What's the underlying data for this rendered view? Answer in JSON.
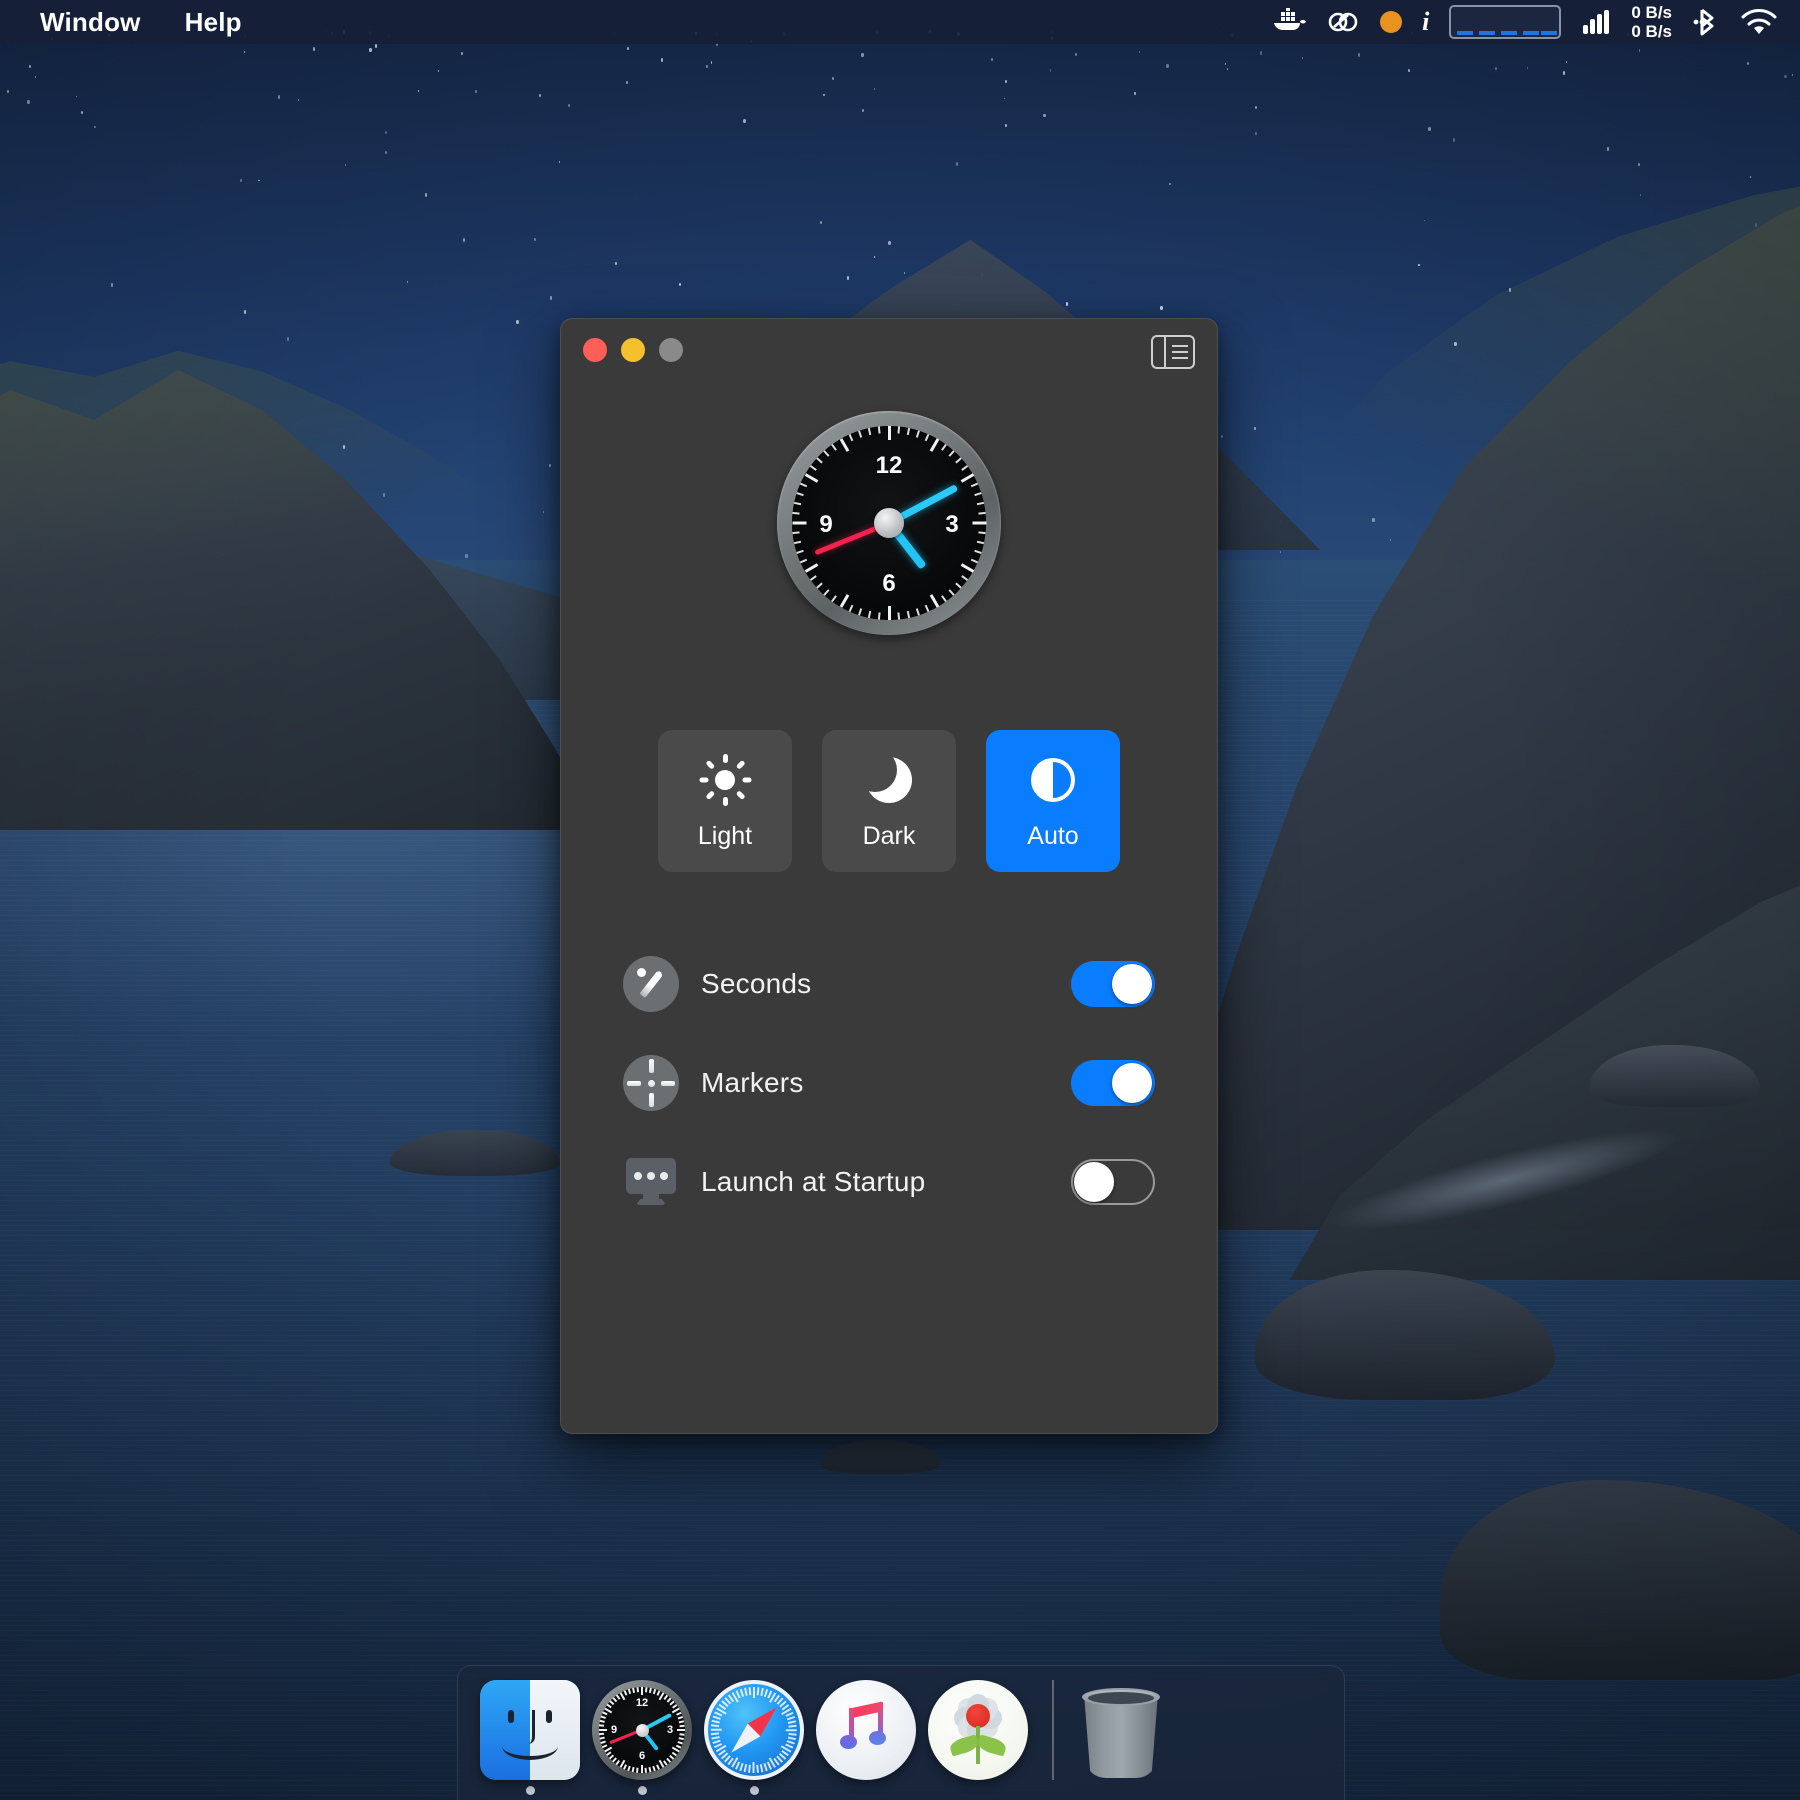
{
  "menubar": {
    "items": [
      {
        "label": "Window",
        "name": "menu-window"
      },
      {
        "label": "Help",
        "name": "menu-help"
      }
    ],
    "status": {
      "docker_icon": "docker-whale-icon",
      "creative_cloud_icon": "adobe-creative-cloud-icon",
      "orange_dot_icon": "orange-status-dot-icon",
      "info_icon": "info-i-icon",
      "graph_icon": "network-graph-icon",
      "signal_icon": "signal-bars-icon",
      "bluetooth_icon": "bluetooth-icon",
      "wifi_icon": "wifi-icon",
      "upload_speed": "0 B/s",
      "download_speed": "0 B/s"
    }
  },
  "window": {
    "title": "",
    "traffic_lights": {
      "close": "close-button",
      "minimize": "minimize-button",
      "zoom": "zoom-button"
    },
    "sidebar_toggle_icon": "sidebar-toggle-icon",
    "clock": {
      "numerals": [
        "12",
        "3",
        "6",
        "9"
      ],
      "hour_angle_deg": 142,
      "minute_angle_deg": 62,
      "second_angle_deg": 248,
      "hour_hand_color": "#22c3f5",
      "minute_hand_color": "#2ac9f8",
      "second_hand_color": "#f4224f",
      "face_color": "#08090a",
      "bezel_color": "#7e8486"
    },
    "appearance": {
      "selected": "Auto",
      "accent_color": "#0a7cff",
      "options": [
        {
          "label": "Light",
          "icon": "sun-icon",
          "selected": false
        },
        {
          "label": "Dark",
          "icon": "moon-icon",
          "selected": false
        },
        {
          "label": "Auto",
          "icon": "half-circle-icon",
          "selected": true
        }
      ]
    },
    "settings": [
      {
        "label": "Seconds",
        "icon": "clock-needle-icon",
        "state": "on"
      },
      {
        "label": "Markers",
        "icon": "clock-markers-icon",
        "state": "on"
      },
      {
        "label": "Launch at Startup",
        "icon": "display-monitor-icon",
        "state": "off"
      }
    ]
  },
  "dock": {
    "items": [
      {
        "name": "dock-item-finder",
        "label": "Finder",
        "icon": "finder-icon",
        "running": true
      },
      {
        "name": "dock-item-clock",
        "label": "Clock",
        "icon": "clock-app-icon",
        "running": true
      },
      {
        "name": "dock-item-safari",
        "label": "Safari",
        "icon": "safari-compass-icon",
        "running": true
      },
      {
        "name": "dock-item-music",
        "label": "Music",
        "icon": "music-note-icon",
        "running": false
      },
      {
        "name": "dock-item-photos",
        "label": "Photos",
        "icon": "photos-flower-icon",
        "running": false
      },
      {
        "name": "dock-item-trash",
        "label": "Trash",
        "icon": "trash-bin-icon",
        "running": false
      }
    ]
  }
}
